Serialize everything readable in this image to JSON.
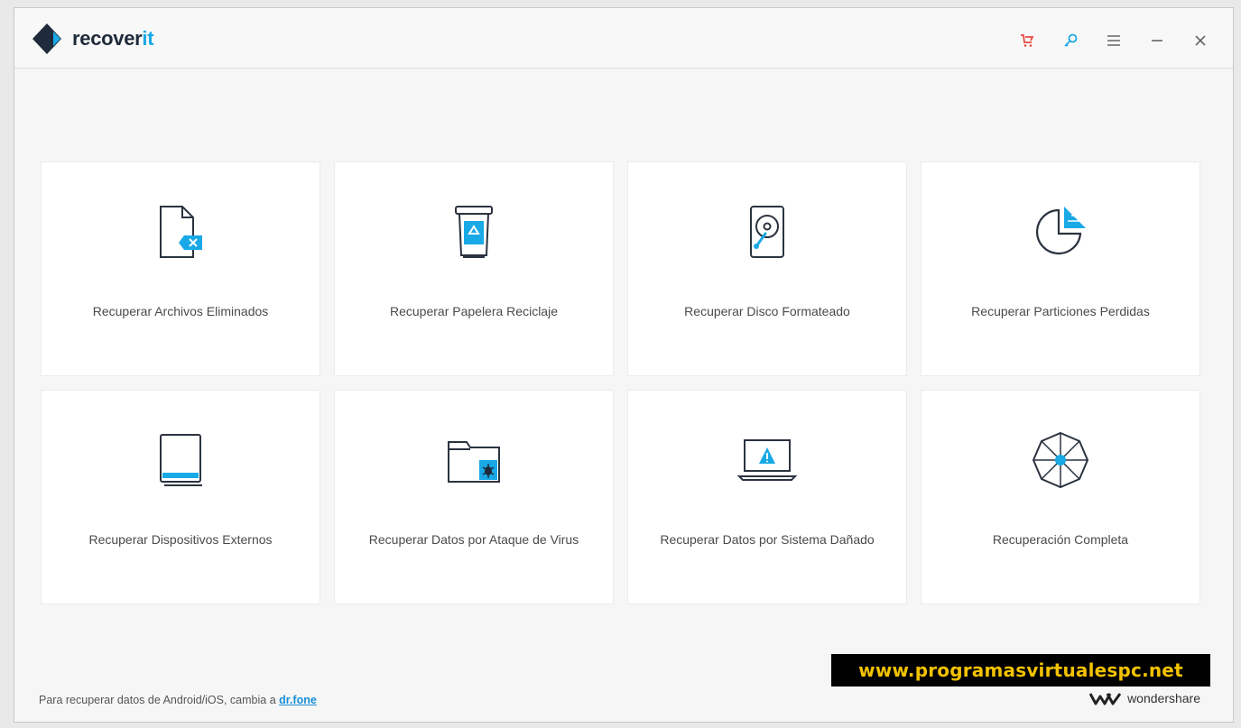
{
  "app": {
    "logo_text_main": "recover",
    "logo_text_accent": "it"
  },
  "colors": {
    "accent": "#18a9e6",
    "cart": "#e8483f",
    "icon_dark": "#2b3340"
  },
  "titlebar": {
    "icons": [
      "cart-icon",
      "key-icon",
      "menu-icon",
      "minimize-icon",
      "close-icon"
    ]
  },
  "cards": [
    {
      "label": "Recuperar Archivos Eliminados",
      "icon": "deleted-file-icon"
    },
    {
      "label": "Recuperar Papelera Reciclaje",
      "icon": "recycle-bin-icon"
    },
    {
      "label": "Recuperar Disco Formateado",
      "icon": "hard-disk-icon"
    },
    {
      "label": "Recuperar Particiones Perdidas",
      "icon": "partition-icon"
    },
    {
      "label": "Recuperar Dispositivos Externos",
      "icon": "external-device-icon"
    },
    {
      "label": "Recuperar Datos por Ataque de Virus",
      "icon": "virus-folder-icon"
    },
    {
      "label": "Recuperar Datos por Sistema Dañado",
      "icon": "crashed-system-icon"
    },
    {
      "label": "Recuperación Completa",
      "icon": "complete-recovery-icon"
    }
  ],
  "footer": {
    "note_text": "Para recuperar datos de Android/iOS, cambia a ",
    "link_text": "dr.fone",
    "watermark": "www.programasvirtualespc.net",
    "brand": "wondershare"
  }
}
